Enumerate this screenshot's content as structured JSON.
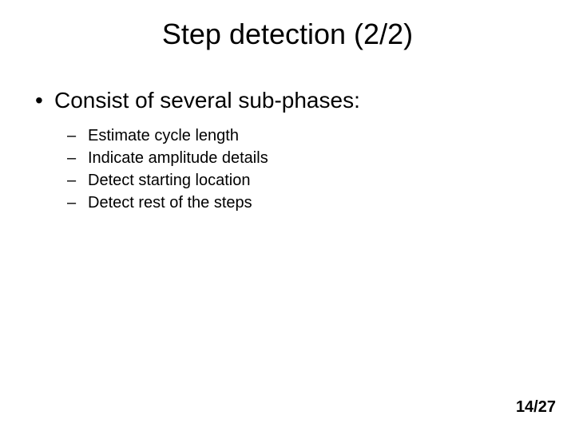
{
  "title": "Step detection (2/2)",
  "bullet": "Consist of several sub-phases:",
  "subitems": [
    "Estimate cycle length",
    "Indicate amplitude details",
    "Detect starting location",
    "Detect rest of the steps"
  ],
  "pagenum": "14/27"
}
